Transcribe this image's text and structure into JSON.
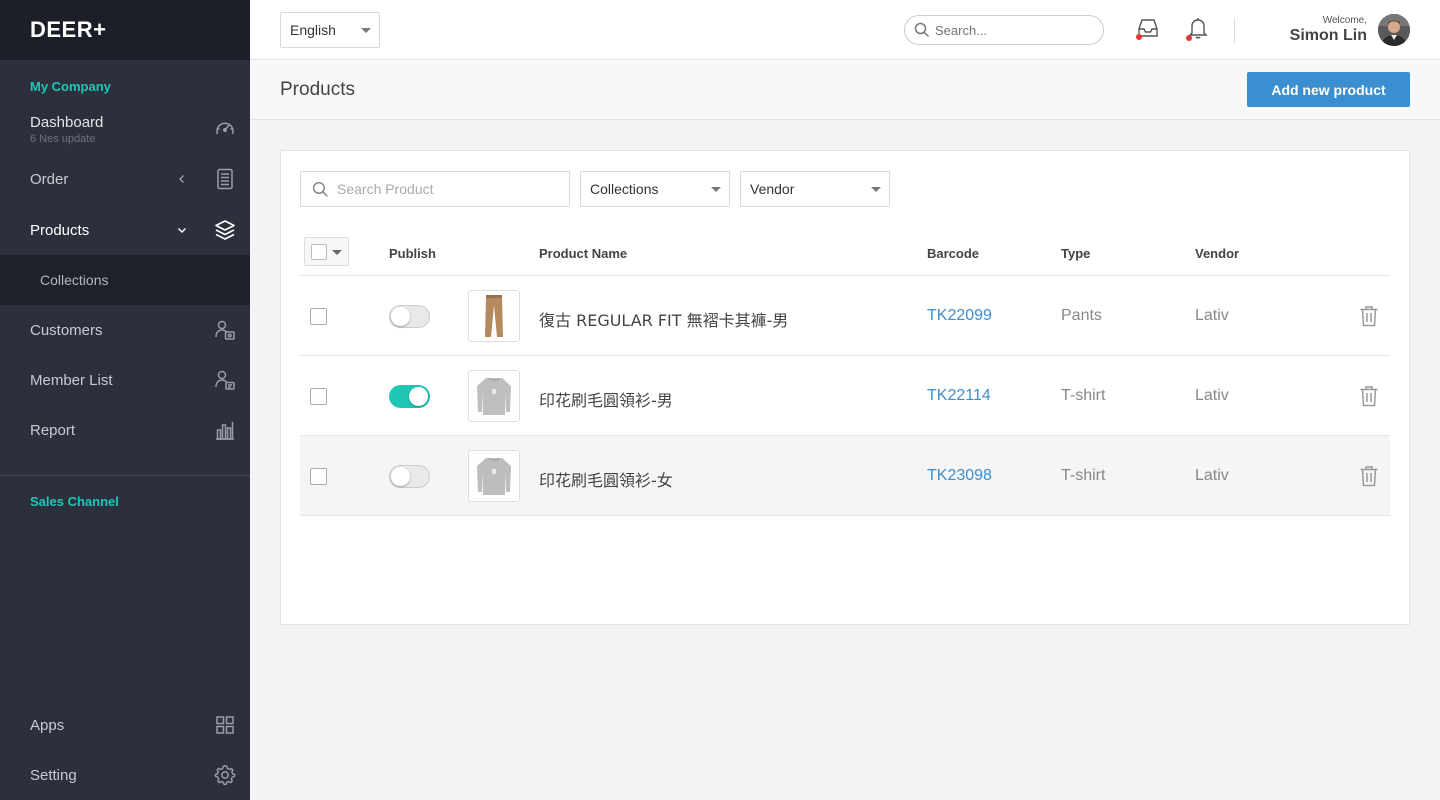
{
  "app": {
    "brand": "DEER+"
  },
  "sidebar": {
    "section_company": "My Company",
    "dashboard": {
      "label": "Dashboard",
      "sub": "6 Nes update"
    },
    "items": [
      {
        "label": "Order",
        "icon": "document-list-icon"
      },
      {
        "label": "Products",
        "icon": "boxes-icon"
      },
      {
        "label": "Collections"
      },
      {
        "label": "Customers",
        "icon": "customers-icon"
      },
      {
        "label": "Member List",
        "icon": "member-list-icon"
      },
      {
        "label": "Report",
        "icon": "bar-chart-icon"
      }
    ],
    "section_sales": "Sales Channel",
    "apps": {
      "label": "Apps",
      "icon": "grid-icon"
    },
    "setting": {
      "label": "Setting",
      "icon": "gear-icon"
    }
  },
  "topbar": {
    "language": "English",
    "search_placeholder": "Search...",
    "welcome": "Welcome,",
    "user_name": "Simon Lin"
  },
  "page": {
    "title": "Products",
    "add_button": "Add new product"
  },
  "filters": {
    "search_placeholder": "Search Product",
    "collections": "Collections",
    "vendor": "Vendor"
  },
  "table": {
    "columns": [
      "Publish",
      "Product Name",
      "Barcode",
      "Type",
      "Vendor"
    ],
    "rows": [
      {
        "published": false,
        "name": "復古 REGULAR FIT 無褶卡其褲-男",
        "barcode": "TK22099",
        "type": "Pants",
        "vendor": "Lativ",
        "thumb": "pants"
      },
      {
        "published": true,
        "name": "印花刷毛圓領衫-男",
        "barcode": "TK22114",
        "type": "T-shirt",
        "vendor": "Lativ",
        "thumb": "sweatshirt"
      },
      {
        "published": false,
        "name": "印花刷毛圓領衫-女",
        "barcode": "TK23098",
        "type": "T-shirt",
        "vendor": "Lativ",
        "thumb": "sweatshirt"
      }
    ]
  },
  "colors": {
    "accent_teal": "#1cc8b5",
    "primary_blue": "#3b8fd0",
    "sidebar_bg": "#2c303d",
    "notification_red": "#e53935"
  }
}
